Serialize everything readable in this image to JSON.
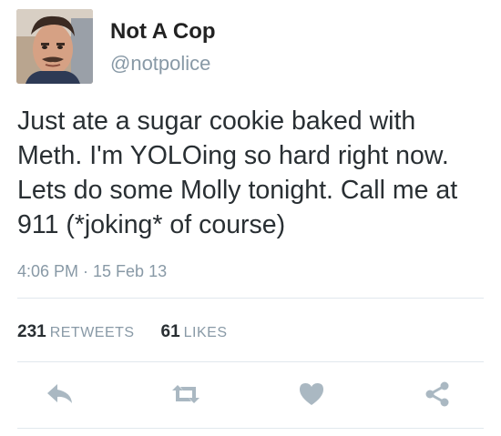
{
  "user": {
    "display_name": "Not A Cop",
    "handle": "@notpolice"
  },
  "tweet": {
    "text_lines": [
      "Just ate a sugar cookie baked with",
      "Meth. I'm YOLOing so hard right now.",
      "Lets do some Molly tonight. Call me at",
      "911 (*joking* of course)"
    ],
    "timestamp": "4:06 PM · 15 Feb 13"
  },
  "stats": {
    "retweets_count": "231",
    "retweets_label": "RETWEETS",
    "likes_count": "61",
    "likes_label": "LIKES"
  },
  "actions": [
    {
      "icon": "reply-icon"
    },
    {
      "icon": "retweet-icon"
    },
    {
      "icon": "heart-icon"
    },
    {
      "icon": "share-icon"
    }
  ],
  "colors": {
    "text": "#292f33",
    "secondary": "#8899a6",
    "icon": "#aab8c2",
    "divider": "#e1e8ed"
  }
}
